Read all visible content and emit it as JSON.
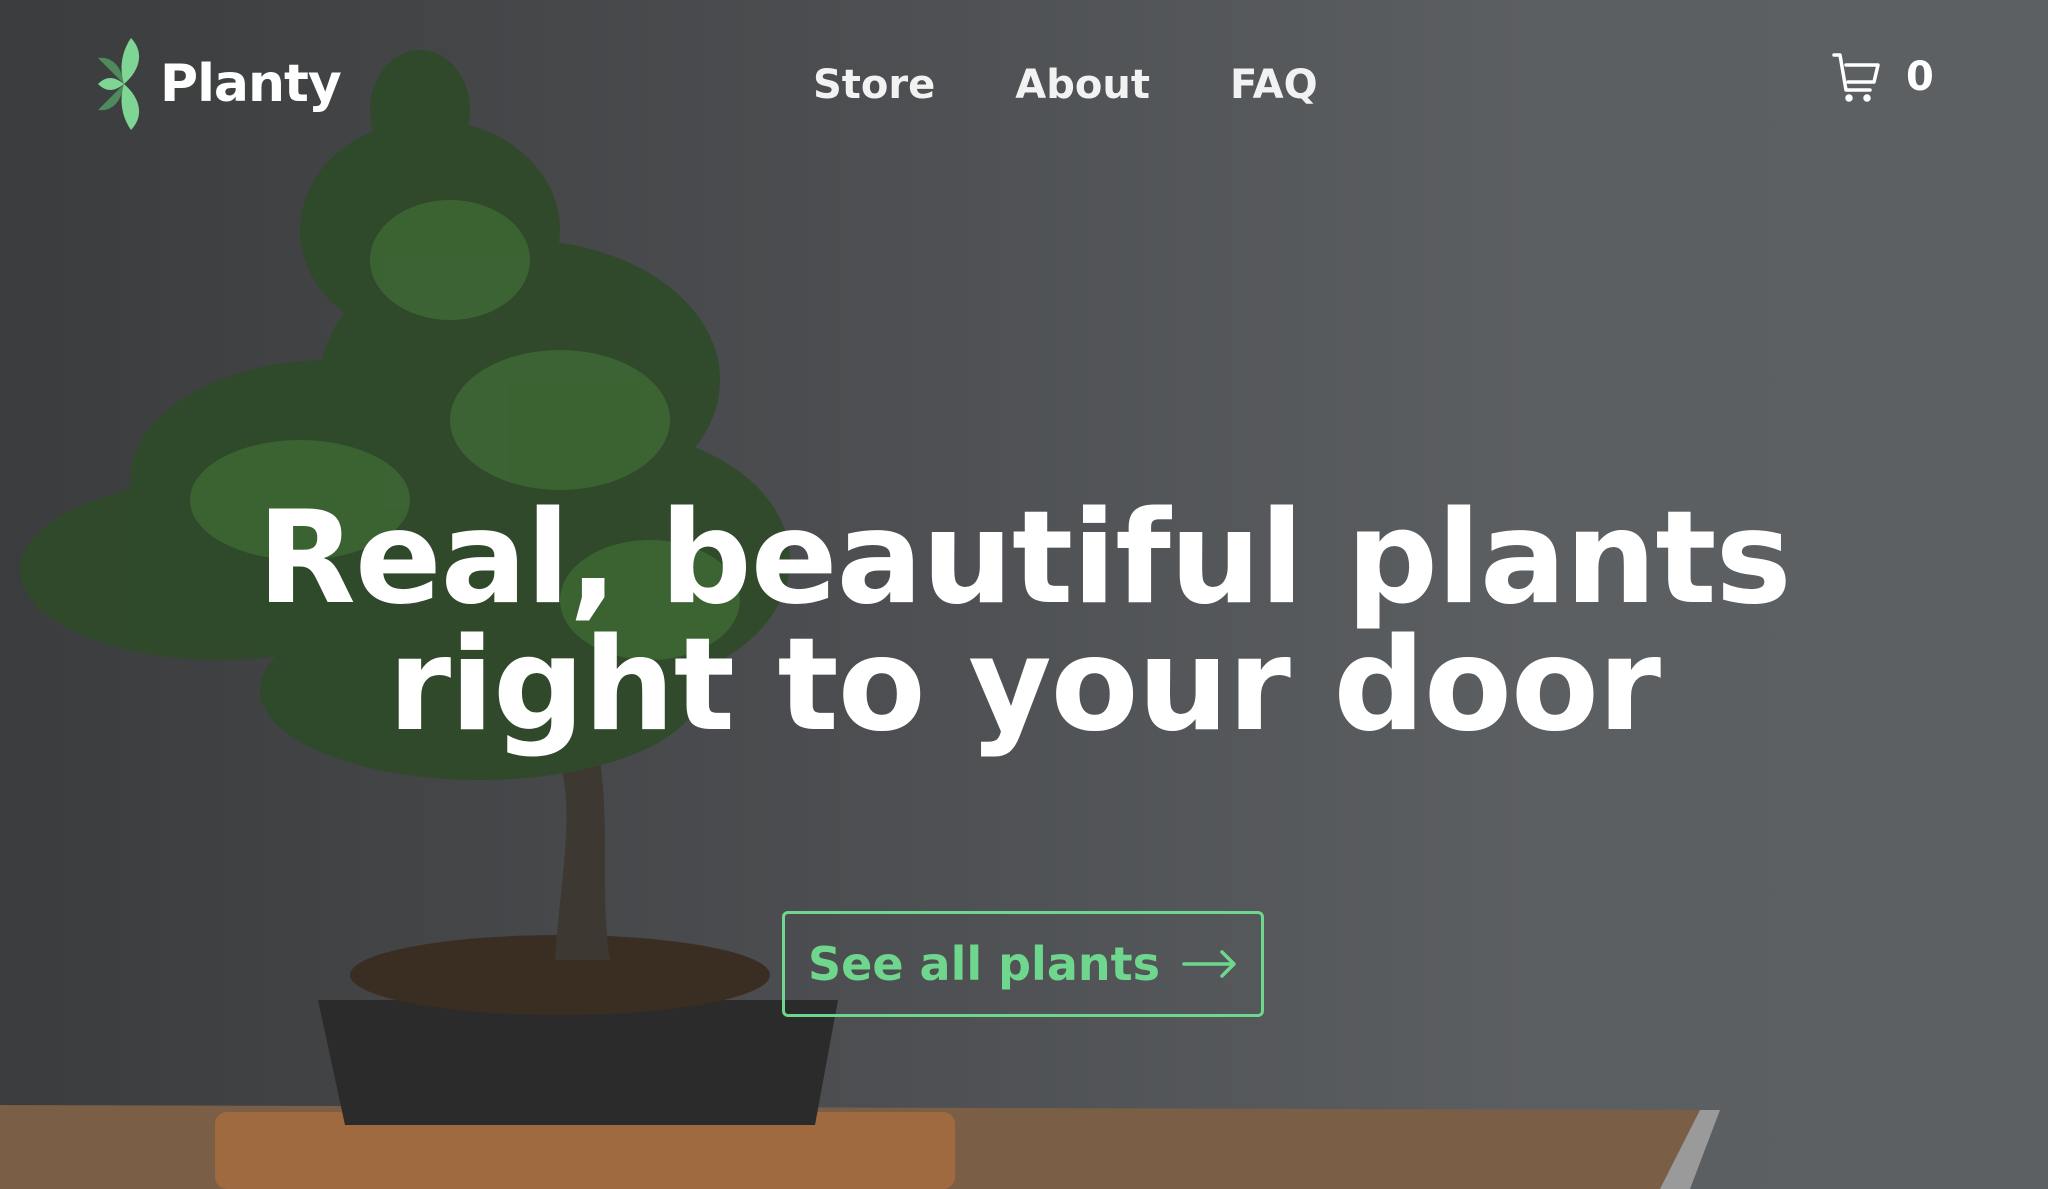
{
  "brand": {
    "name": "Planty",
    "accent": "#6fd68d"
  },
  "nav": {
    "links": [
      "Store",
      "About",
      "FAQ"
    ]
  },
  "cart": {
    "icon": "cart-icon",
    "count": "0"
  },
  "hero": {
    "line1": "Real, beautiful plants",
    "line2": "right to your door"
  },
  "cta": {
    "label": "See all plants",
    "icon": "arrow-right-icon"
  }
}
